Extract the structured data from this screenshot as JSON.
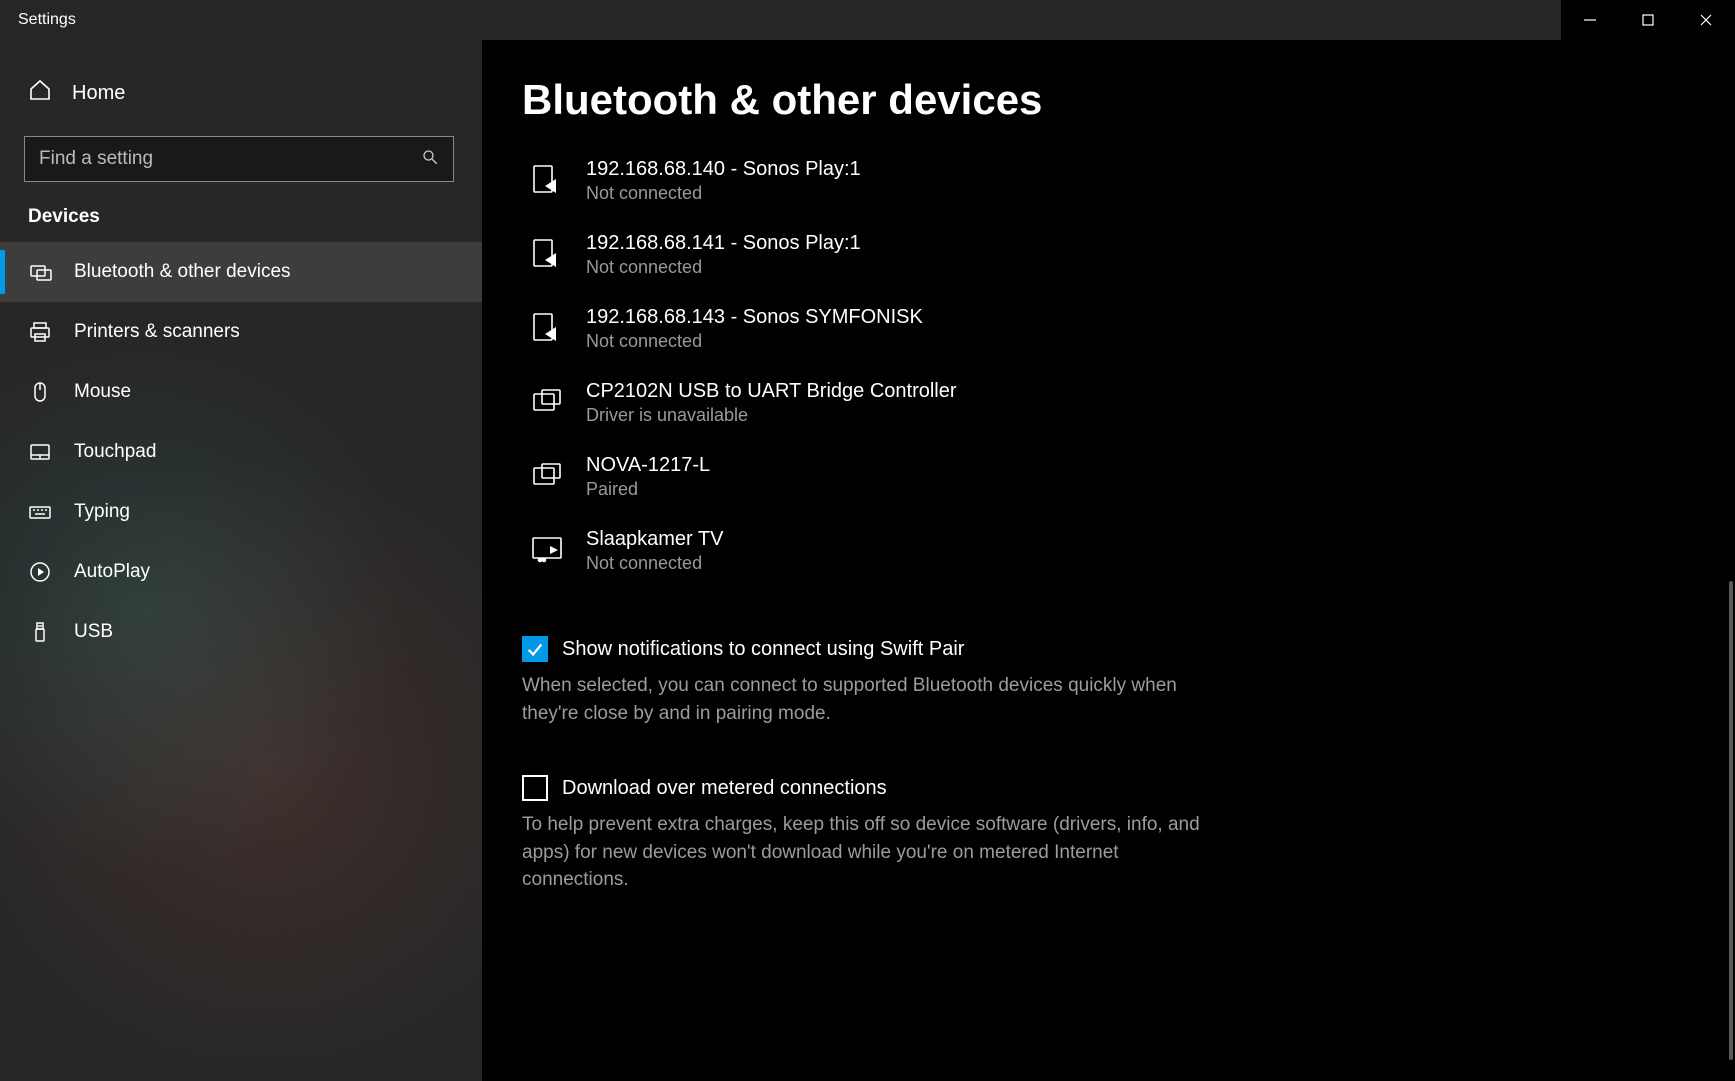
{
  "window": {
    "title": "Settings"
  },
  "sidebar": {
    "home_label": "Home",
    "search_placeholder": "Find a setting",
    "category": "Devices",
    "items": [
      {
        "label": "Bluetooth & other devices",
        "icon": "bluetooth-devices",
        "active": true
      },
      {
        "label": "Printers & scanners",
        "icon": "printer",
        "active": false
      },
      {
        "label": "Mouse",
        "icon": "mouse",
        "active": false
      },
      {
        "label": "Touchpad",
        "icon": "touchpad",
        "active": false
      },
      {
        "label": "Typing",
        "icon": "keyboard",
        "active": false
      },
      {
        "label": "AutoPlay",
        "icon": "autoplay",
        "active": false
      },
      {
        "label": "USB",
        "icon": "usb",
        "active": false
      }
    ]
  },
  "page": {
    "title": "Bluetooth & other devices"
  },
  "devices": [
    {
      "name": "192.168.68.140 - Sonos Play:1",
      "status": "Not connected",
      "icon": "media-cast"
    },
    {
      "name": "192.168.68.141 - Sonos Play:1",
      "status": "Not connected",
      "icon": "media-cast"
    },
    {
      "name": "192.168.68.143 - Sonos SYMFONISK",
      "status": "Not connected",
      "icon": "media-cast"
    },
    {
      "name": "CP2102N USB to UART Bridge Controller",
      "status": "Driver is unavailable",
      "icon": "generic-device"
    },
    {
      "name": "NOVA-1217-L",
      "status": "Paired",
      "icon": "generic-device"
    },
    {
      "name": "Slaapkamer TV",
      "status": "Not connected",
      "icon": "media-tv"
    }
  ],
  "options": {
    "swift_pair": {
      "label": "Show notifications to connect using Swift Pair",
      "checked": true,
      "description": "When selected, you can connect to supported Bluetooth devices quickly when they're close by and in pairing mode."
    },
    "metered": {
      "label": "Download over metered connections",
      "checked": false,
      "description": "To help prevent extra charges, keep this off so device software (drivers, info, and apps) for new devices won't download while you're on metered Internet connections."
    }
  },
  "colors": {
    "accent": "#0099e5"
  }
}
